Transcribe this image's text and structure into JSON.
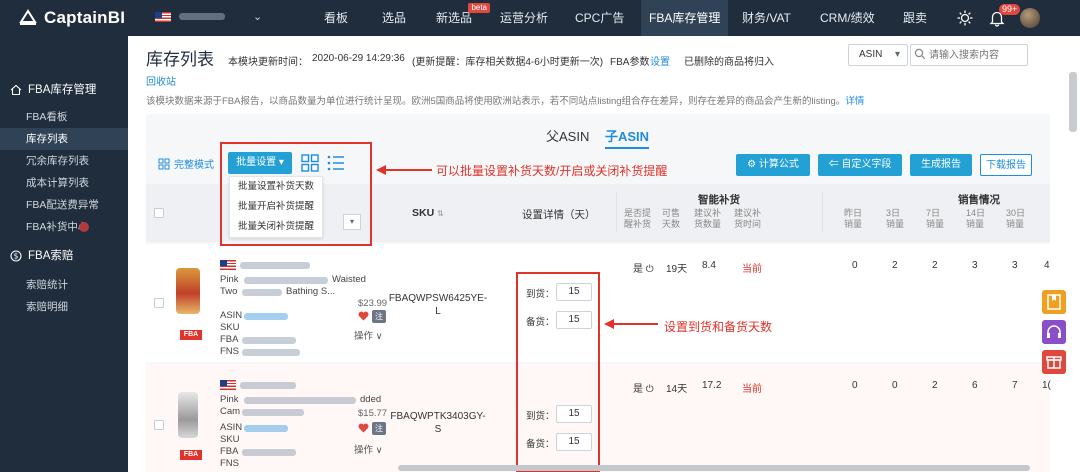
{
  "app": {
    "name": "CaptainBI"
  },
  "topnav": {
    "items": [
      "看板",
      "选品",
      "新选品",
      "运营分析",
      "CPC广告",
      "FBA库存管理",
      "财务/VAT",
      "CRM/绩效",
      "跟卖"
    ],
    "beta": "beta",
    "notification_count": "99+"
  },
  "sidebar": {
    "section1": "FBA库存管理",
    "items1": [
      "FBA看板",
      "库存列表",
      "冗余库存列表",
      "成本计算列表",
      "FBA配送费异常",
      "FBA补货中心"
    ],
    "section2": "FBA索赔",
    "items2": [
      "索赔统计",
      "索赔明细"
    ]
  },
  "header": {
    "title": "库存列表",
    "update_label": "本模块更新时间：",
    "update_time": "2020-06-29 14:29:36",
    "update_hint": "(更新提醒：库存相关数据4-6小时更新一次)",
    "fba_param": "FBA参数",
    "settings_link": "设置",
    "deleted_note": "已删除的商品将归入",
    "recycle": "回收站",
    "note": "该模块数据来源于FBA报告，以商品数量为单位进行统计呈现。欧洲5国商品将使用欧洲站表示，若不同站点listing组合存在差异，则存在差异的商品会产生新的listing。",
    "note_link": "详情",
    "search_type": "ASIN",
    "search_placeholder": "请输入搜索内容"
  },
  "panel": {
    "tabs": [
      "父ASIN",
      "子ASIN"
    ],
    "full_mode": "完整模式",
    "batch_btn": "批量设置",
    "dropdown": [
      "批量设置补货天数",
      "批量开启补货提醒",
      "批量关闭补货提醒"
    ],
    "annotation1": "可以批量设置补货天数/开启或关闭补货提醒",
    "annotation2": "设置到货和备货天数",
    "buttons": [
      "计算公式",
      "自定义字段",
      "生成报告",
      "下载报告"
    ]
  },
  "table": {
    "headers": {
      "sku": "SKU",
      "setting": "设置详情（天）",
      "smart": "智能补货",
      "sales": "销售情况"
    },
    "smart_sub": [
      "是否提醒补货",
      "可售天数",
      "建议补货数量",
      "建议补货时间"
    ],
    "sales_sub": [
      "昨日销量",
      "3日销量",
      "7日销量",
      "14日销量",
      "30日销量"
    ],
    "rows": [
      {
        "title_a": "Pink",
        "title_b": "Waisted",
        "title_c": "Two",
        "title_d": "Bathing S...",
        "price": "$23.99",
        "asin": "ASIN",
        "sku_l": "SKU",
        "fba": "FBA",
        "fns": "FNS",
        "ops": "操作",
        "sku": "FBAQWPSW6425YE-L",
        "arrive_label": "到货：",
        "arrive": "15",
        "stock_label": "备货：",
        "stock": "15",
        "remind": "是",
        "days": "19天",
        "qty": "8.4",
        "time": "当前",
        "sales": [
          "0",
          "2",
          "2",
          "3",
          "3",
          "4"
        ]
      },
      {
        "title_a": "Pink",
        "title_b": "dded",
        "title_c": "Cam",
        "title_d": "",
        "price": "$15.77",
        "asin": "ASIN",
        "sku_l": "SKU",
        "fba": "FBA",
        "fns": "FNS",
        "ops": "操作",
        "sku": "FBAQWPTK3403GY-S",
        "arrive_label": "到货：",
        "arrive": "15",
        "stock_label": "备货：",
        "stock": "15",
        "remind": "是",
        "days": "14天",
        "qty": "17.2",
        "time": "当前",
        "sales": [
          "0",
          "0",
          "2",
          "6",
          "7",
          "1("
        ]
      }
    ]
  },
  "colors": {
    "nav_bg": "#1f2d3d",
    "accent": "#1e8de0",
    "teal": "#23a1d5",
    "red": "#e0332b"
  }
}
